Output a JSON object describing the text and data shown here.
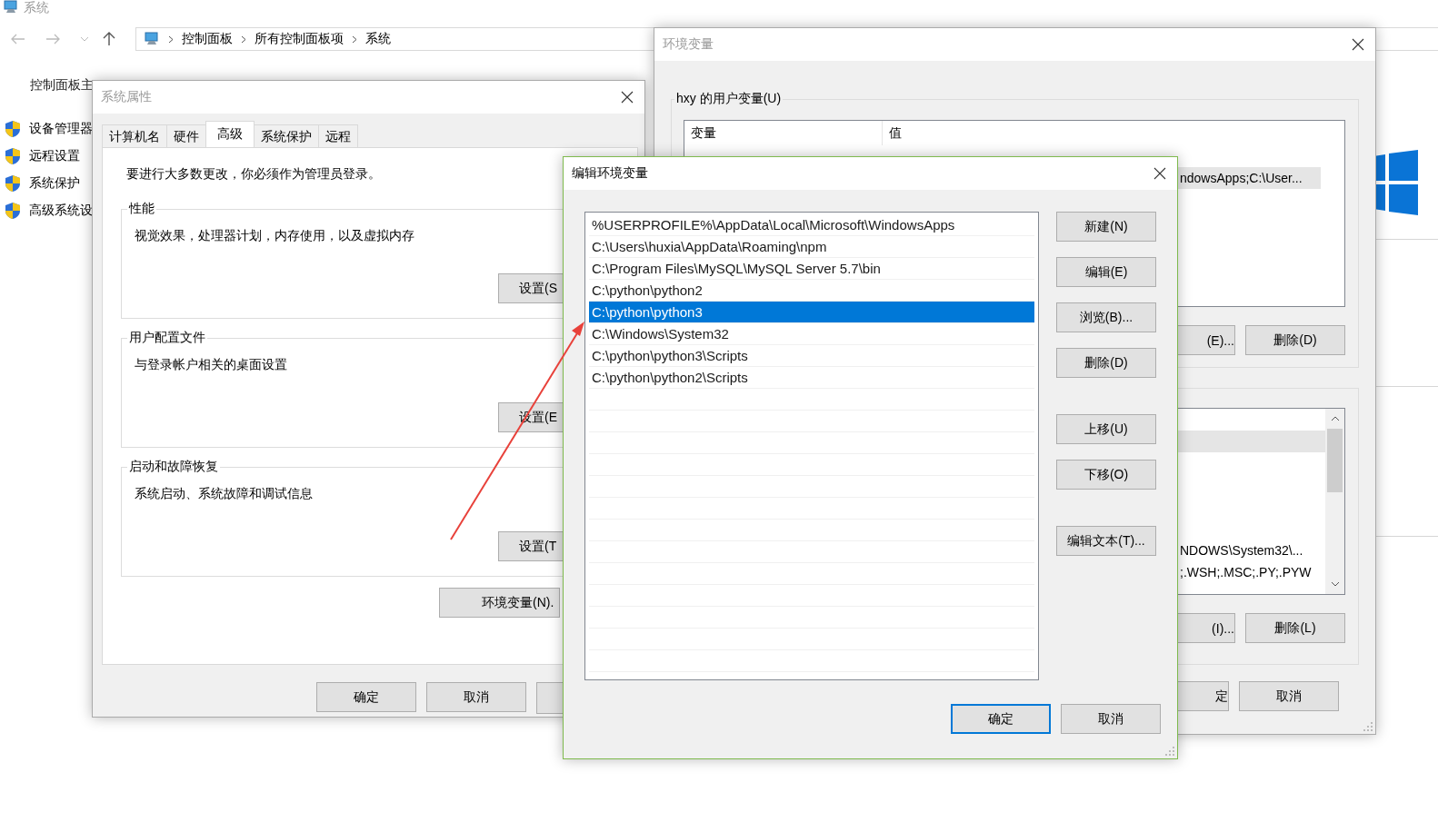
{
  "explorer": {
    "title": "系统",
    "breadcrumb": [
      "控制面板",
      "所有控制面板项",
      "系统"
    ],
    "sidebar_title": "控制面板主",
    "sidebar_items": [
      "设备管理器",
      "远程设置",
      "系统保护",
      "高级系统设"
    ]
  },
  "system_properties": {
    "title": "系统属性",
    "tabs": [
      {
        "label": "计算机名",
        "selected": false
      },
      {
        "label": "硬件",
        "selected": false
      },
      {
        "label": "高级",
        "selected": true
      },
      {
        "label": "系统保护",
        "selected": false
      },
      {
        "label": "远程",
        "selected": false
      }
    ],
    "admin_note": "要进行大多数更改，你必须作为管理员登录。",
    "groups": [
      {
        "title": "性能",
        "description": "视觉效果，处理器计划，内存使用，以及虚拟内存",
        "button": "设置(S"
      },
      {
        "title": "用户配置文件",
        "description": "与登录帐户相关的桌面设置",
        "button": "设置(E"
      },
      {
        "title": "启动和故障恢复",
        "description": "系统启动、系统故障和调试信息",
        "button": "设置(T"
      }
    ],
    "env_button": "环境变量(N).",
    "buttons": [
      "确定",
      "取消"
    ]
  },
  "environment_variables": {
    "title": "环境变量",
    "user_group": "hxy 的用户变量(U)",
    "user_columns": [
      "变量",
      "值"
    ],
    "user_rows": [
      {
        "selected": false
      },
      {
        "value": "ndowsApps;C:\\User...",
        "selected": true
      }
    ],
    "user_buttons": [
      "(E)...",
      "删除(D)"
    ],
    "system_rows": [
      {
        "selected": false
      },
      {
        "selected": true
      },
      {
        "selected": false
      },
      {
        "selected": false
      },
      {
        "selected": false
      },
      {
        "selected": false
      },
      {
        "value": "NDOWS\\System32\\...",
        "selected": false
      },
      {
        "value": ";.WSH;.MSC;.PY;.PYW",
        "selected": false
      }
    ],
    "system_buttons": [
      "(I)...",
      "删除(L)"
    ],
    "buttons": [
      "定",
      "取消"
    ]
  },
  "edit_dialog": {
    "title": "编辑环境变量",
    "entries": [
      {
        "text": "%USERPROFILE%\\AppData\\Local\\Microsoft\\WindowsApps",
        "selected": false
      },
      {
        "text": "C:\\Users\\huxia\\AppData\\Roaming\\npm",
        "selected": false
      },
      {
        "text": "C:\\Program Files\\MySQL\\MySQL Server 5.7\\bin",
        "selected": false
      },
      {
        "text": "C:\\python\\python2",
        "selected": false
      },
      {
        "text": "C:\\python\\python3",
        "selected": true
      },
      {
        "text": "C:\\Windows\\System32",
        "selected": false
      },
      {
        "text": "C:\\python\\python3\\Scripts",
        "selected": false
      },
      {
        "text": "C:\\python\\python2\\Scripts",
        "selected": false
      }
    ],
    "side_button_groups": [
      [
        "新建(N)",
        "编辑(E)",
        "浏览(B)...",
        "删除(D)"
      ],
      [
        "上移(U)",
        "下移(O)"
      ],
      [
        "编辑文本(T)..."
      ]
    ],
    "buttons": [
      {
        "label": "确定",
        "default": true
      },
      {
        "label": "取消",
        "default": false
      }
    ]
  }
}
